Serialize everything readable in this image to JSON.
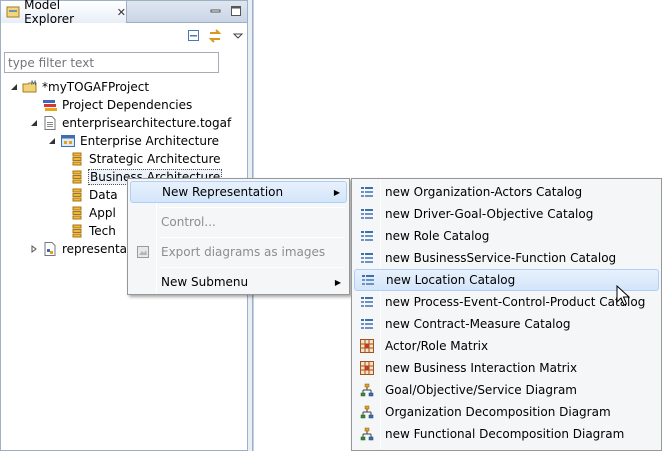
{
  "view": {
    "tab_title": "Model Explorer",
    "close_glyph": "✕",
    "filter_placeholder": "type filter text"
  },
  "tree": {
    "project": "*myTOGAFProject",
    "project_dependencies": "Project Dependencies",
    "file": "enterprisearchitecture.togaf",
    "enterprise_architecture": "Enterprise Architecture",
    "strategic": "Strategic Architecture",
    "business": "Business Architecture",
    "data": "Data",
    "appl": "Appl",
    "tech": "Tech",
    "representations": "representatio"
  },
  "context_menu": {
    "new_representation": "New Representation",
    "control": "Control...",
    "export": "Export diagrams as images",
    "new_submenu": "New Submenu"
  },
  "submenu": {
    "items": [
      {
        "label": "new Organization-Actors Catalog",
        "icon": "catalog-icon"
      },
      {
        "label": "new Driver-Goal-Objective Catalog",
        "icon": "catalog-icon"
      },
      {
        "label": "new Role Catalog",
        "icon": "catalog-icon"
      },
      {
        "label": "new BusinessService-Function Catalog",
        "icon": "catalog-icon"
      },
      {
        "label": "new Location Catalog",
        "icon": "catalog-icon"
      },
      {
        "label": "new Process-Event-Control-Product Catalog",
        "icon": "catalog-icon"
      },
      {
        "label": "new Contract-Measure Catalog",
        "icon": "catalog-icon"
      },
      {
        "label": "Actor/Role Matrix",
        "icon": "matrix-icon"
      },
      {
        "label": "new Business Interaction Matrix",
        "icon": "matrix-icon"
      },
      {
        "label": "Goal/Objective/Service Diagram",
        "icon": "diagram-icon"
      },
      {
        "label": "Organization Decomposition Diagram",
        "icon": "diagram-icon"
      },
      {
        "label": "new Functional Decomposition Diagram",
        "icon": "diagram-icon"
      }
    ]
  }
}
